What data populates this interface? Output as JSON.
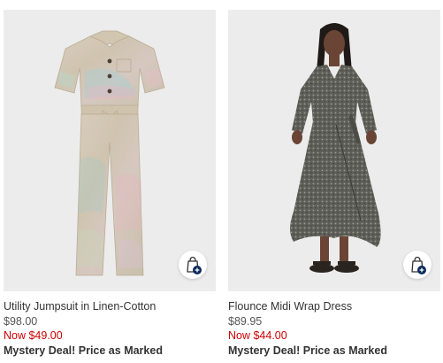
{
  "products": [
    {
      "name": "Utility Jumpsuit in Linen-Cotton",
      "original_price": "$98.00",
      "sale_price": "Now $49.00",
      "promo": "Mystery Deal! Price as Marked",
      "image": "jumpsuit-photo",
      "add_to_bag_icon": "shopping-bag-plus-icon"
    },
    {
      "name": "Flounce Midi Wrap Dress",
      "original_price": "$89.95",
      "sale_price": "Now $44.00",
      "promo": "Mystery Deal! Price as Marked",
      "image": "wrap-dress-photo",
      "add_to_bag_icon": "shopping-bag-plus-icon"
    }
  ],
  "colors": {
    "sale": "#d00000",
    "image_background": "#ececec",
    "badge": "#0b2a5c"
  }
}
